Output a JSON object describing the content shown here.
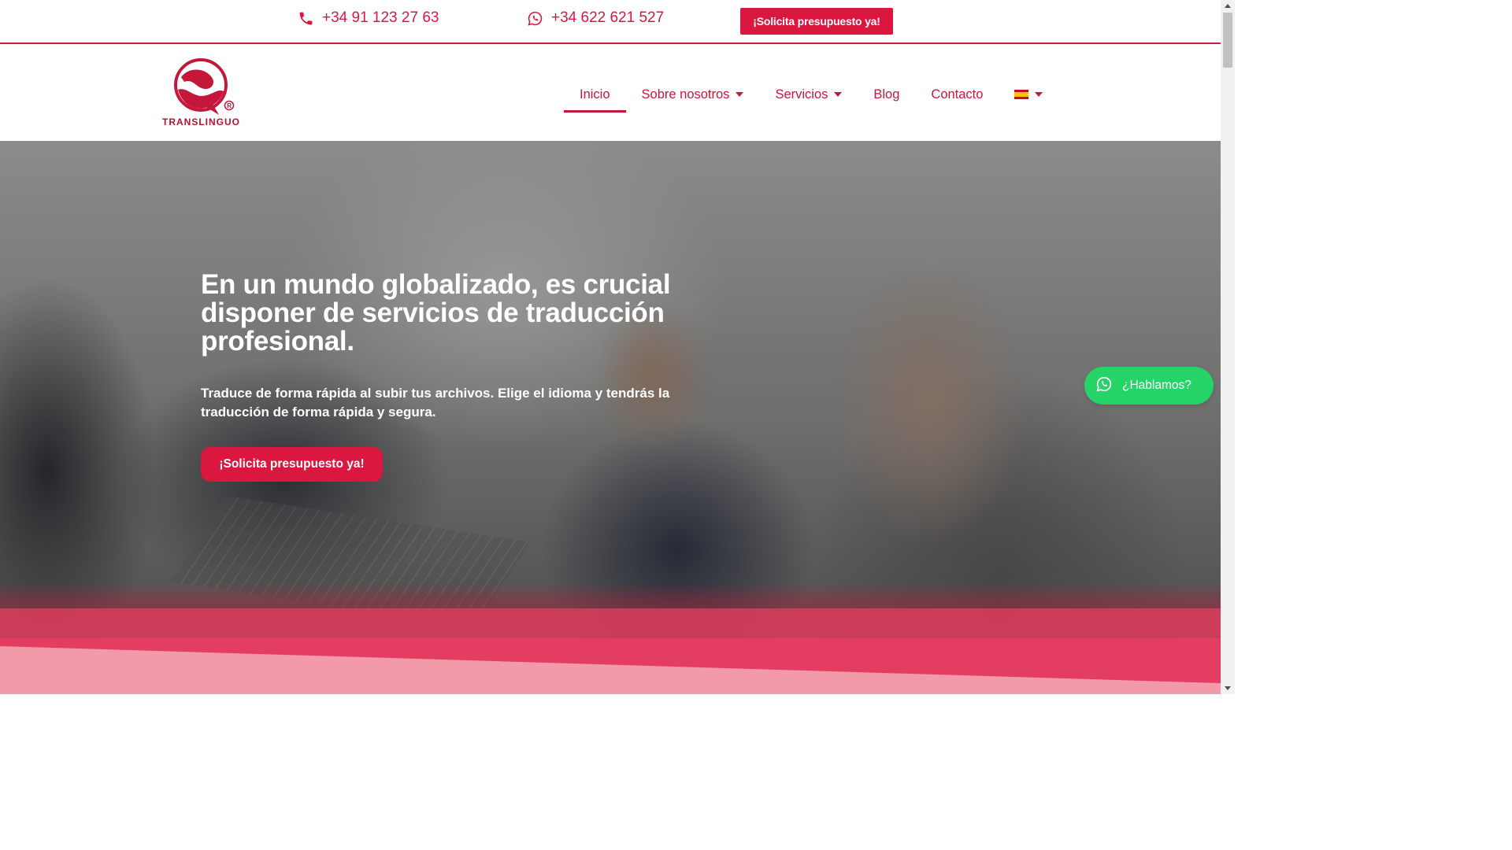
{
  "topbar": {
    "phone": "+34 91 123 27 63",
    "whatsapp": "+34 622 621 527",
    "cta_label": "¡Solicita presupuesto ya!"
  },
  "header": {
    "logo_text": "TRANSLINGUO",
    "nav": [
      {
        "label": "Inicio",
        "active": true
      },
      {
        "label": "Sobre nosotros",
        "dropdown": true
      },
      {
        "label": "Servicios",
        "dropdown": true
      },
      {
        "label": "Blog"
      },
      {
        "label": "Contacto"
      }
    ],
    "language_icon": "spain-flag-icon"
  },
  "hero": {
    "title": "En un mundo globalizado, es crucial disponer de servicios de traducción profesional.",
    "subtitle": "Traduce de forma rápida al subir tus archivos. Elige el idioma y tendrás la traducción de forma rápida y segura.",
    "cta_label": "¡Solicita presupuesto ya!"
  },
  "chat": {
    "label": "¿Hablamos?",
    "icon": "whatsapp-icon"
  },
  "colors": {
    "brand": "#d9173f",
    "whatsapp": "#25d366",
    "band": "#e33d61",
    "wedge": "#f29aaa"
  }
}
